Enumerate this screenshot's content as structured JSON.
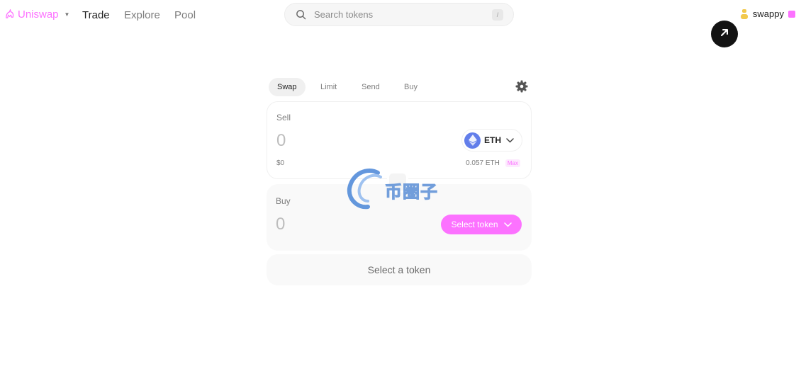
{
  "nav": {
    "brand": "Uniswap",
    "links": [
      "Trade",
      "Explore",
      "Pool"
    ],
    "search": {
      "placeholder": "Search tokens",
      "shortcut": "/"
    },
    "account": {
      "name": "swappy"
    }
  },
  "swap": {
    "tabs": [
      "Swap",
      "Limit",
      "Send",
      "Buy"
    ],
    "active_tab": "Swap",
    "sell": {
      "label": "Sell",
      "amount": "0",
      "fiat": "$0",
      "token": "ETH",
      "balance": "0.057 ETH",
      "max_label": "Max"
    },
    "buy": {
      "label": "Buy",
      "amount": "0",
      "select_label": "Select token"
    },
    "action_label": "Select a token"
  },
  "watermark": {
    "text": "币圈子"
  },
  "colors": {
    "accent": "#fc72ff",
    "eth": "#627eea",
    "dark": "#131313"
  },
  "icons": [
    "uniswap-unicorn-icon",
    "search-icon",
    "settings-gear-icon",
    "eth-icon",
    "chevron-down-icon",
    "arrow-up-right-icon",
    "avatar-icon"
  ]
}
